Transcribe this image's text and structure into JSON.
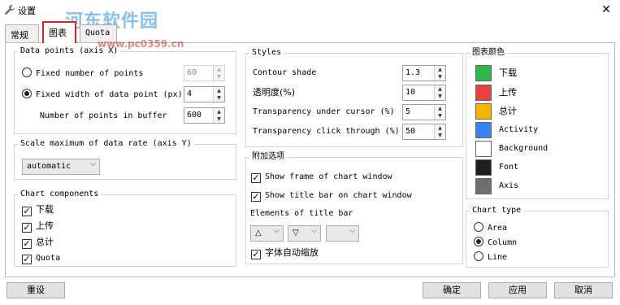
{
  "window": {
    "title": "设置",
    "close_glyph": "✕",
    "watermark": "河东软件园",
    "watermark_url": "www.pc0359.cn"
  },
  "tabs": [
    {
      "label": "常规"
    },
    {
      "label": "图表"
    },
    {
      "label": "Quota"
    }
  ],
  "data_points": {
    "legend": "Data points (axis X)",
    "fixed_number_label": "Fixed number of points",
    "fixed_number_value": "60",
    "fixed_width_label": "Fixed width of data point (px)",
    "fixed_width_value": "4",
    "buffer_label": "Number of points in buffer",
    "buffer_value": "600",
    "selected": "fixed_width"
  },
  "scale": {
    "legend": "Scale maximum of data rate (axis Y)",
    "selected_value": "automatic"
  },
  "components": {
    "legend": "Chart components",
    "items": [
      {
        "label": "下载",
        "checked": true
      },
      {
        "label": "上传",
        "checked": true
      },
      {
        "label": "总计",
        "checked": true
      },
      {
        "label": "Quota",
        "checked": true
      }
    ]
  },
  "styles": {
    "legend": "Styles",
    "contour_label": "Contour shade",
    "contour_value": "1.3",
    "opacity_label": "透明度(%)",
    "opacity_value": "10",
    "under_cursor_label": "Transparency under cursor (%)",
    "under_cursor_value": "5",
    "click_through_label": "Transparency click through (%)",
    "click_through_value": "50"
  },
  "extra": {
    "legend": "附加选项",
    "show_frame_label": "Show frame of chart window",
    "show_title_label": "Show title bar on chart window",
    "elements_label": "Elements of title bar",
    "element_combo1": "△",
    "element_combo2": "▽",
    "element_combo3": "",
    "auto_font_label": "字体自动缩放"
  },
  "colors": {
    "legend": "图表颜色",
    "items": [
      {
        "label": "下载",
        "color": "#2db84a"
      },
      {
        "label": "上传",
        "color": "#e8403a"
      },
      {
        "label": "总计",
        "color": "#f5b400"
      },
      {
        "label": "Activity",
        "color": "#3b82f0"
      },
      {
        "label": "Background",
        "color": "#ffffff"
      },
      {
        "label": "Font",
        "color": "#1e1e1e"
      },
      {
        "label": "Axis",
        "color": "#6e6e6e"
      }
    ]
  },
  "chart_type": {
    "legend": "Chart type",
    "options": [
      {
        "label": "Area",
        "selected": false
      },
      {
        "label": "Column",
        "selected": true
      },
      {
        "label": "Line",
        "selected": false
      }
    ]
  },
  "footer": {
    "reset_label": "重设",
    "ok_label": "确定",
    "apply_label": "应用",
    "cancel_label": "取消"
  }
}
